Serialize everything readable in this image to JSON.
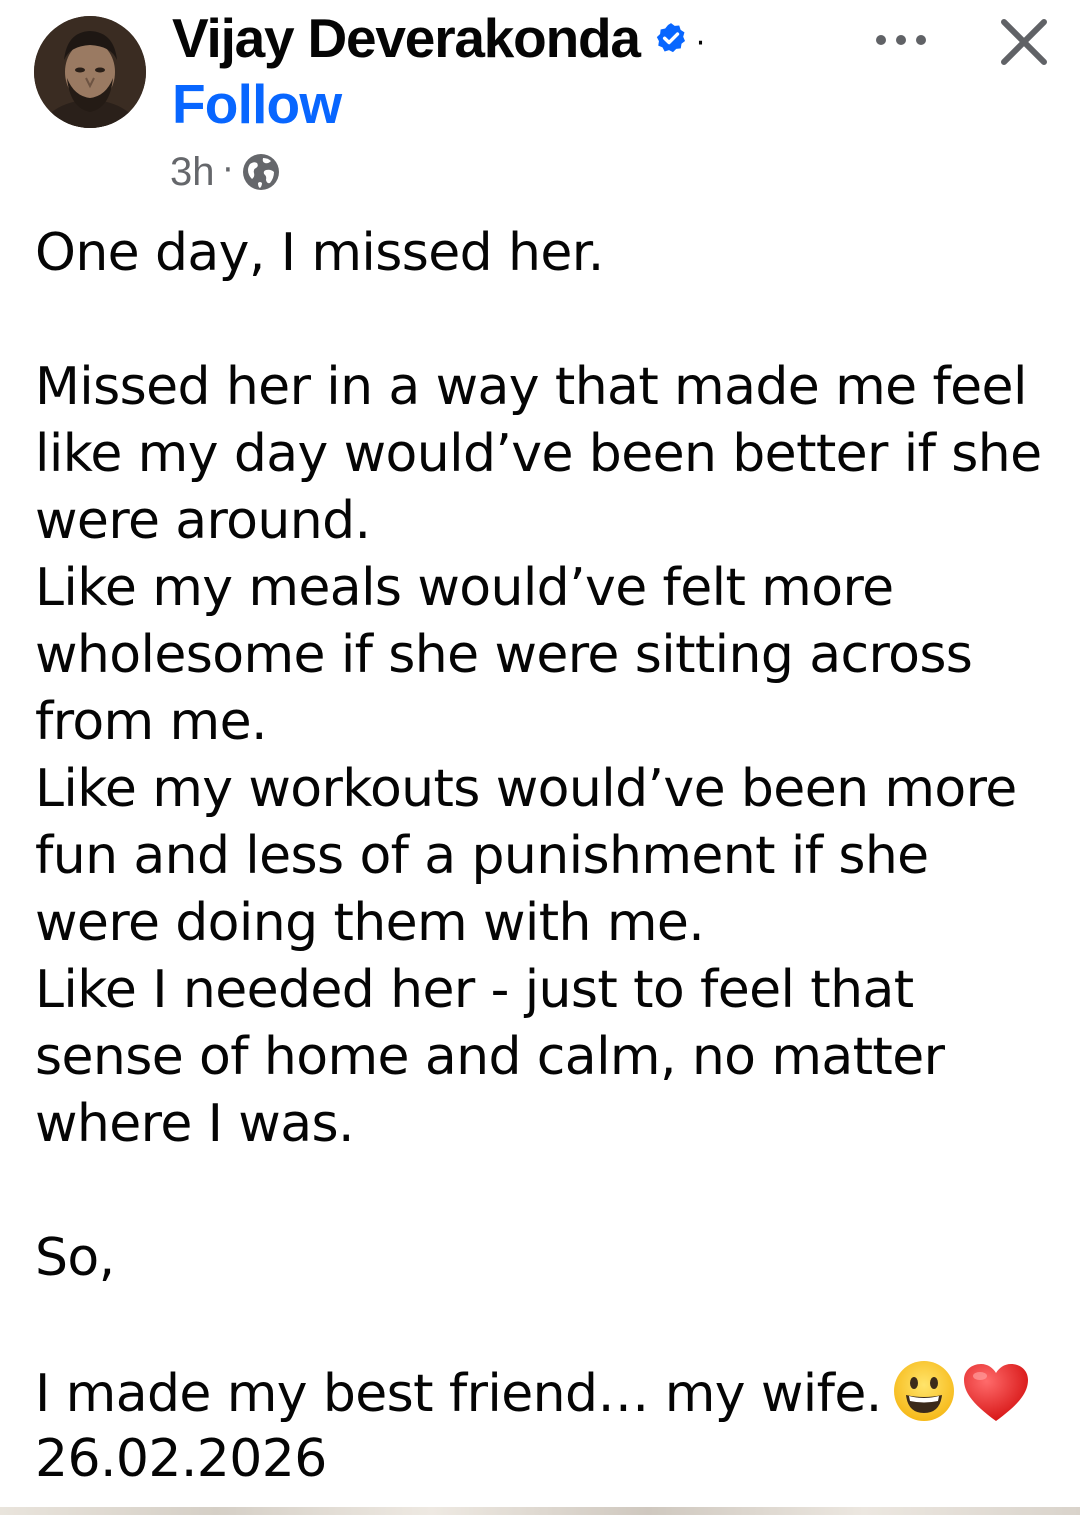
{
  "post": {
    "author": {
      "name": "Vijay Deverakonda",
      "verified": true,
      "separator": "·",
      "follow_label": "Follow",
      "avatar_icon": "profile-photo"
    },
    "meta": {
      "time": "3h",
      "separator": "·",
      "audience_icon": "globe-icon"
    },
    "actions": {
      "more_icon": "more-options-icon",
      "close_icon": "close-icon"
    },
    "body": {
      "line_1": "One day, I missed her.",
      "line_2": "Missed her in a way that made me feel",
      "line_3": "like my day would’ve been better if she",
      "line_4": "were around.",
      "line_5": "Like my meals would’ve felt more",
      "line_6": "wholesome if she were sitting across",
      "line_7": "from me.",
      "line_8": "Like my workouts would’ve been more",
      "line_9": "fun and less of a punishment if she",
      "line_10": "were doing them with me.",
      "line_11": "Like I needed her - just to feel that",
      "line_12": "sense of home and calm, no matter",
      "line_13": "where I was.",
      "line_14": "So,",
      "line_15": "I made my best friend… my wife.",
      "line_16": "26.02.2026",
      "emojis": [
        "grinning-face-emoji",
        "red-heart-emoji"
      ]
    },
    "colors": {
      "text": "#050505",
      "link": "#0866ff",
      "secondary": "#65676b",
      "verified_badge": "#0866ff"
    }
  }
}
